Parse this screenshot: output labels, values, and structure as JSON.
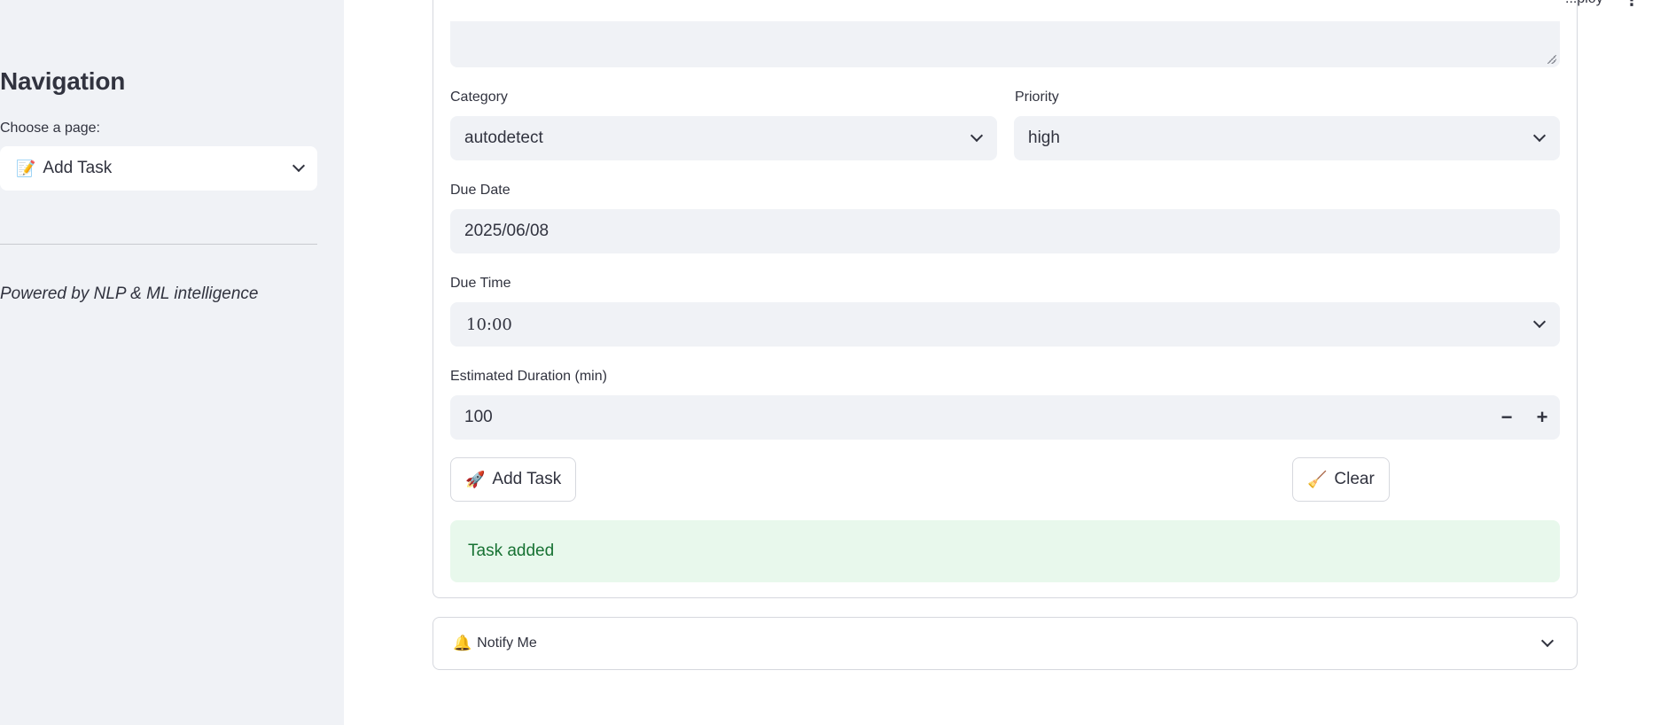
{
  "sidebar": {
    "title": "Navigation",
    "select_label": "Choose a page:",
    "select_emoji": "📝",
    "select_value": "Add Task",
    "footer_text": "Powered by NLP & ML intelligence"
  },
  "topbar": {
    "partial_text": "...ploy",
    "menu_glyph": "⋮"
  },
  "form": {
    "category": {
      "label": "Category",
      "value": "autodetect"
    },
    "priority": {
      "label": "Priority",
      "value": "high"
    },
    "due_date": {
      "label": "Due Date",
      "value": "2025/06/08"
    },
    "due_time": {
      "label": "Due Time",
      "value": "10:00"
    },
    "duration": {
      "label": "Estimated Duration (min)",
      "value": "100",
      "minus": "−",
      "plus": "+"
    },
    "add_button": {
      "emoji": "🚀",
      "label": "Add Task"
    },
    "clear_button": {
      "emoji": "🧹",
      "label": "Clear"
    },
    "success_message": "Task added"
  },
  "expander": {
    "emoji": "🔔",
    "label": "Notify Me"
  },
  "colors": {
    "sidebar_bg": "#f0f2f6",
    "input_bg": "#f0f2f6",
    "success_bg": "#e8f8ec",
    "success_text": "#177233",
    "text": "#31333f"
  }
}
